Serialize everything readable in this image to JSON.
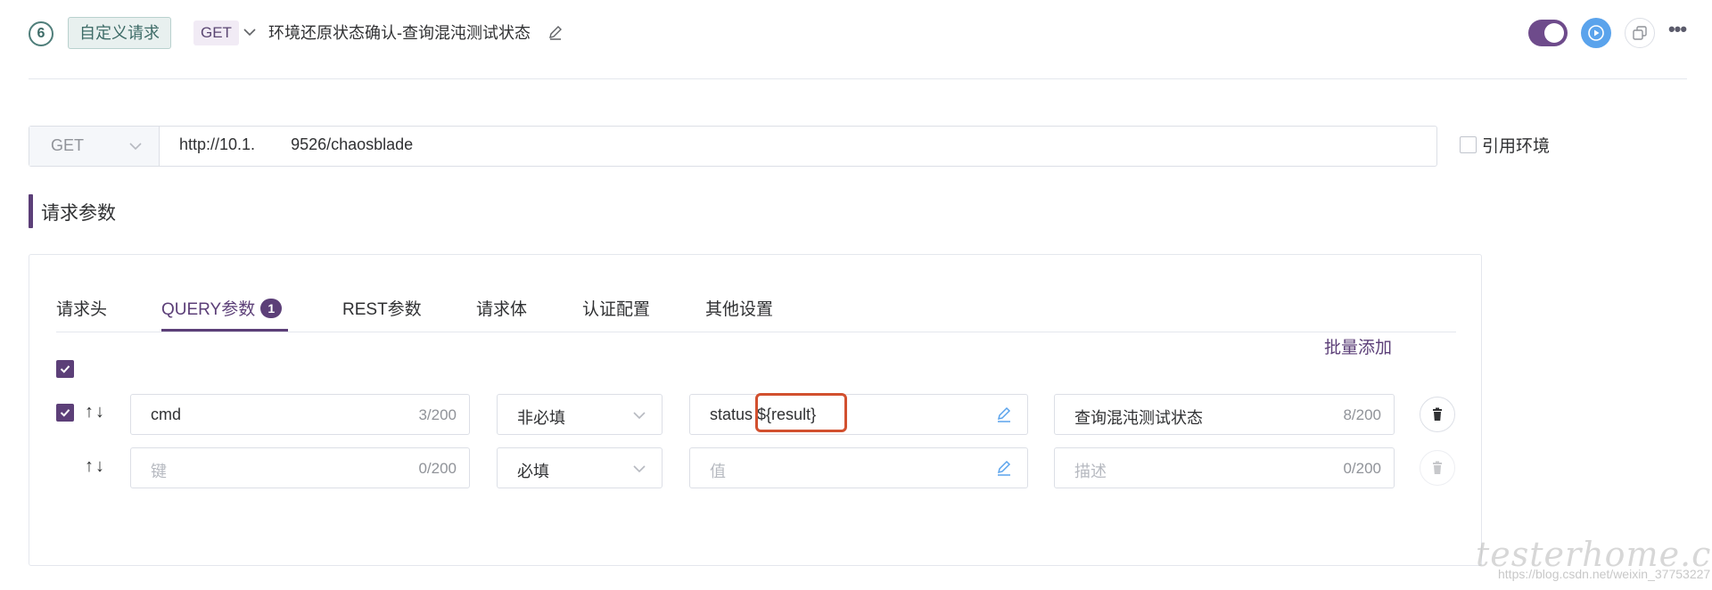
{
  "step": {
    "index": "6",
    "type_label": "自定义请求",
    "method": "GET",
    "name": "环境还原状态确认-查询混沌测试状态",
    "enabled": true
  },
  "request": {
    "method": "GET",
    "url": "http://10.1.        9526/chaosblade",
    "use_env_label": "引用环境"
  },
  "section": {
    "title": "请求参数"
  },
  "tabs": [
    {
      "label": "请求头"
    },
    {
      "label": "QUERY参数",
      "badge": "1"
    },
    {
      "label": "REST参数"
    },
    {
      "label": "请求体"
    },
    {
      "label": "认证配置"
    },
    {
      "label": "其他设置"
    }
  ],
  "batch_add_label": "批量添加",
  "params": [
    {
      "checked": true,
      "key": "cmd",
      "key_count": "3/200",
      "required": "非必填",
      "value": "status ${result}",
      "description": "查询混沌测试状态",
      "description_count": "8/200"
    },
    {
      "checked": false,
      "key_placeholder": "键",
      "key_count": "0/200",
      "required": "必填",
      "value_placeholder": "值",
      "description_placeholder": "描述",
      "description_count": "0/200"
    }
  ],
  "watermark": {
    "text": "testerhome.com",
    "url": "https://blog.csdn.net/weixin_37753227"
  },
  "colors": {
    "accent": "#5c3f78",
    "run": "#5aa3ec",
    "highlight": "#d2502f"
  }
}
